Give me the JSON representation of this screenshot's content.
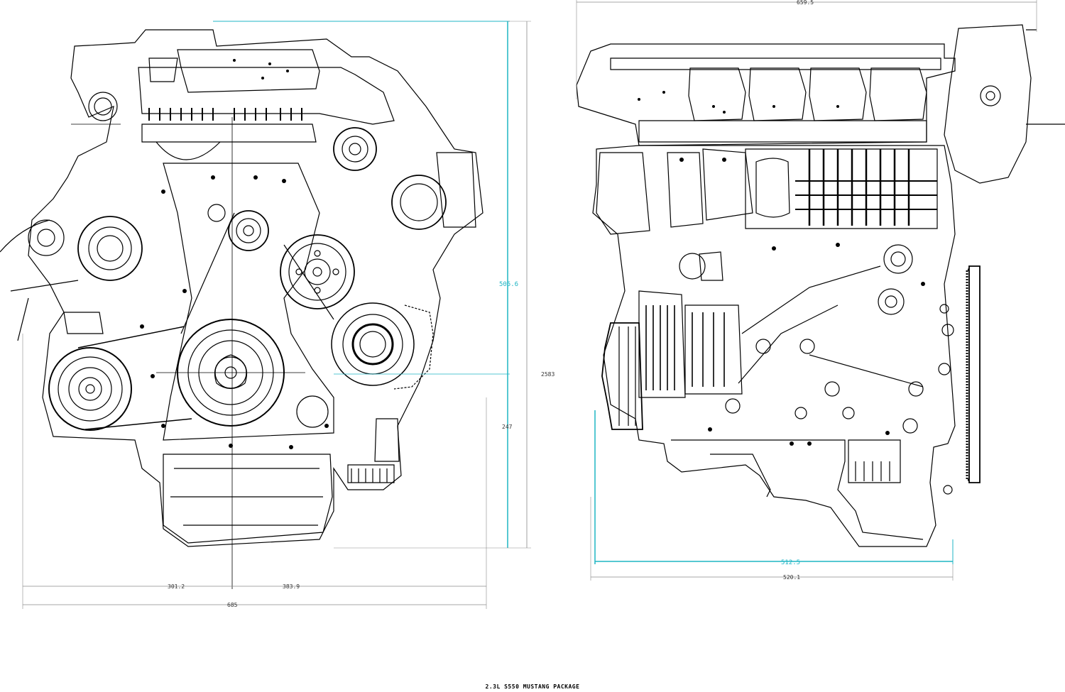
{
  "title": "2.3L S550 MUSTANG PACKAGE",
  "accent_color": "#1fb5c4",
  "line_color": "#000000",
  "dim_line_color": "#8a8a8a",
  "front_view": {
    "dimensions": {
      "height_total": "505.6",
      "height_partial": "2583",
      "height_lower": "247",
      "width_left": "301.2",
      "width_right": "383.9",
      "width_total": "685"
    }
  },
  "side_view": {
    "dimensions": {
      "width_top": "659.5",
      "width_bottom_cyan": "512.5",
      "width_bottom": "520.1"
    }
  }
}
